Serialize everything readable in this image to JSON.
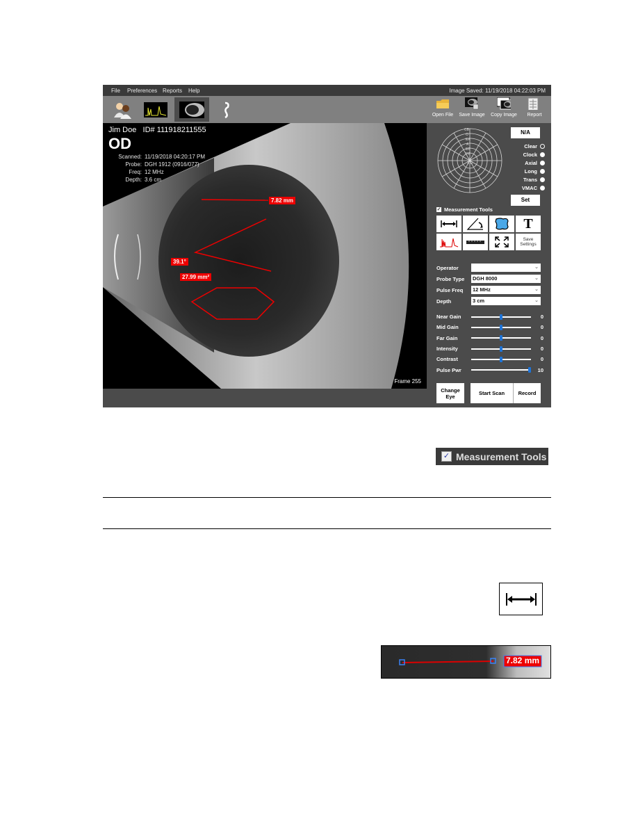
{
  "menu": {
    "items": [
      "File",
      "Preferences",
      "Reports",
      "Help"
    ],
    "image_saved": "Image Saved:  11/19/2018   04:22:03  PM"
  },
  "toolbar": {
    "left_icons": [
      "patients-icon",
      "a-scan-icon",
      "b-scan-icon",
      "probe-icon"
    ],
    "active_index": 2,
    "right_buttons": [
      {
        "label": "Open File",
        "icon": "folder-icon"
      },
      {
        "label": "Save Image",
        "icon": "save-image-icon"
      },
      {
        "label": "Copy Image",
        "icon": "copy-image-icon"
      },
      {
        "label": "Report",
        "icon": "report-icon"
      }
    ]
  },
  "patient": {
    "name": "Jim Doe",
    "id": "ID# 111918211555",
    "eye": "OD",
    "meta": [
      {
        "key": "Scanned:",
        "value": "11/19/2018   04:20:17  PM"
      },
      {
        "key": "Probe:",
        "value": "DGH 1912 (0916/077)"
      },
      {
        "key": "Freq:",
        "value": "12 MHz"
      },
      {
        "key": "Depth:",
        "value": "3.6 cm"
      }
    ]
  },
  "viewer": {
    "frame": "Frame 255",
    "measurements": {
      "distance": "7.82 mm",
      "angle": "39.1°",
      "area": "27.99 mm²"
    }
  },
  "panel": {
    "nav_button": "N/A",
    "polar_labels": [
      "CB",
      "O",
      "EA",
      "A",
      "EP",
      "PP",
      "P",
      "X D"
    ],
    "radios": [
      {
        "label": "Clear",
        "selected": true
      },
      {
        "label": "Clock",
        "selected": false
      },
      {
        "label": "Axial",
        "selected": false
      },
      {
        "label": "Long",
        "selected": false
      },
      {
        "label": "Trans",
        "selected": false
      },
      {
        "label": "VMAC",
        "selected": false
      }
    ],
    "set_button": "Set",
    "measurement_tools": {
      "label": "Measurement Tools",
      "checked": true
    },
    "tools": [
      {
        "name": "distance-tool",
        "icon": "distance-icon"
      },
      {
        "name": "angle-tool",
        "icon": "angle-icon"
      },
      {
        "name": "area-tool",
        "icon": "area-icon"
      },
      {
        "name": "text-tool",
        "label": "T"
      },
      {
        "name": "a-scan-tool",
        "icon": "a-scan-icon"
      },
      {
        "name": "ruler-tool",
        "icon": "ruler-icon"
      },
      {
        "name": "fullscreen-tool",
        "icon": "expand-icon"
      },
      {
        "name": "save-settings",
        "label": "Save Settings"
      }
    ],
    "fields": [
      {
        "label": "Operator",
        "value": ""
      },
      {
        "label": "Probe Type",
        "value": "DGH 8000"
      },
      {
        "label": "Pulse Freq",
        "value": "12 MHz"
      },
      {
        "label": "Depth",
        "value": "3 cm"
      }
    ],
    "sliders": [
      {
        "label": "Near Gain",
        "value": "0",
        "fraction": 0.5
      },
      {
        "label": "Mid Gain",
        "value": "0",
        "fraction": 0.5
      },
      {
        "label": "Far Gain",
        "value": "0",
        "fraction": 0.5
      },
      {
        "label": "Intensity",
        "value": "0",
        "fraction": 0.5
      },
      {
        "label": "Contrast",
        "value": "0",
        "fraction": 0.5
      },
      {
        "label": "Pulse Pwr",
        "value": "10",
        "fraction": 1.0
      }
    ],
    "buttons": {
      "change_eye": "Change Eye",
      "start_scan": "Start Scan",
      "record": "Record"
    }
  },
  "callouts": {
    "measurement_tools_label": "Measurement Tools",
    "sample_label": "7.82 mm"
  },
  "colors": {
    "accent_blue": "#1e74d8",
    "measure_red": "#e00000",
    "panel_bg": "#4b4b4b"
  }
}
